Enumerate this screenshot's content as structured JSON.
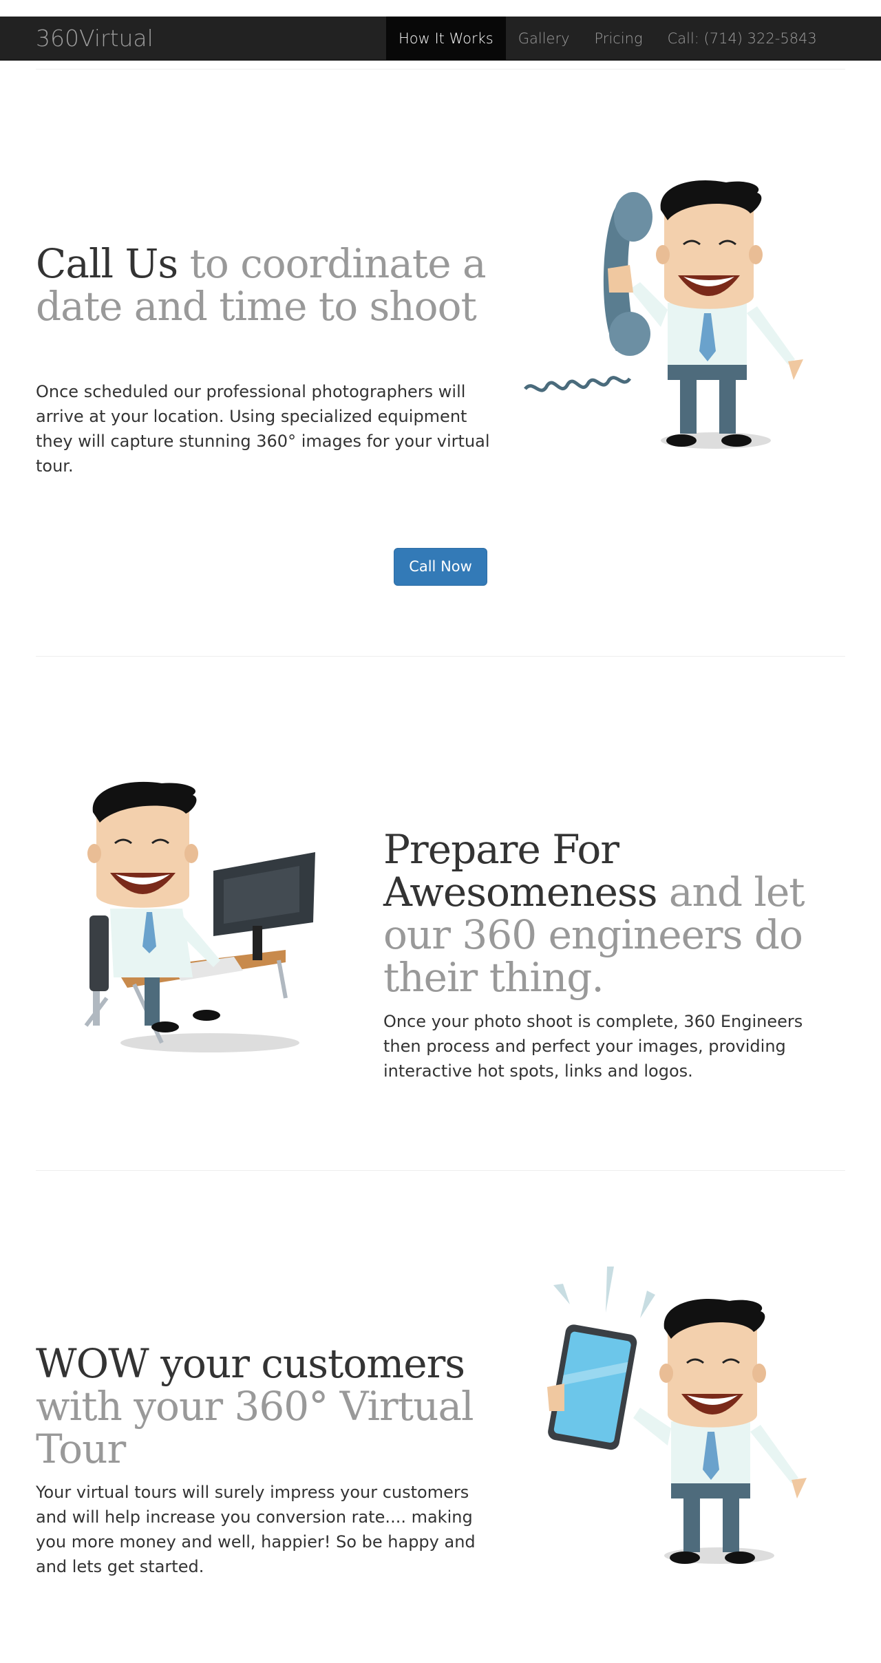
{
  "navbar": {
    "brand": "360Virtual",
    "items": [
      {
        "label": "How It Works",
        "active": true
      },
      {
        "label": "Gallery",
        "active": false
      },
      {
        "label": "Pricing",
        "active": false
      },
      {
        "label": "Call: (714) 322-5843",
        "active": false
      }
    ]
  },
  "sections": [
    {
      "heading_strong": "Call Us",
      "heading_muted": " to coordinate a date and time to shoot",
      "text": "Once scheduled our professional photographers will arrive at your location. Using specialized equipment they will capture stunning 360° images for your virtual tour.",
      "image": "businessman-on-phone-illustration"
    },
    {
      "heading_strong": "Prepare For Awesomeness",
      "heading_muted": " and let our 360 engineers do their thing.",
      "text": "Once your photo shoot is complete, 360 Engineers then process and perfect your images, providing interactive hot spots, links and logos.",
      "image": "businessman-at-computer-illustration"
    },
    {
      "heading_strong": "WOW your customers",
      "heading_muted": " with your 360° Virtual Tour",
      "text": "Your virtual tours will surely impress your customers and will help increase you conversion rate.... making you more money and well, happier! So be happy and and lets get started.",
      "image": "businessman-with-tablet-illustration"
    }
  ],
  "cta": {
    "label": "Call Now"
  },
  "colors": {
    "navbar_bg": "#222222",
    "nav_active_bg": "#080808",
    "button": "#337ab7",
    "muted_heading": "#999999"
  }
}
